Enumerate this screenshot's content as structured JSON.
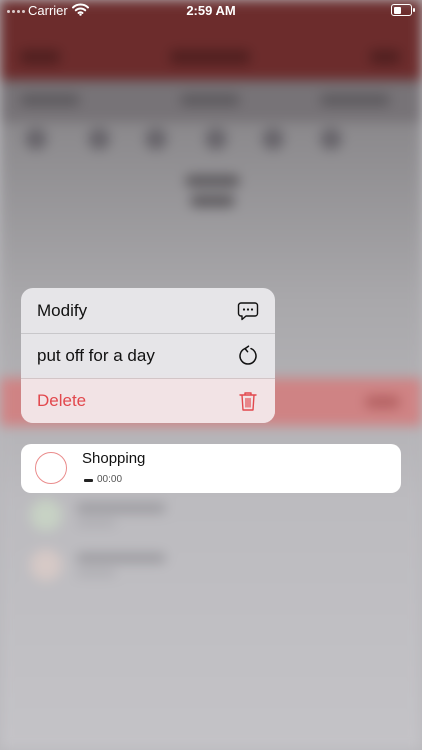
{
  "status_bar": {
    "carrier": "Carrier",
    "time": "2:59 AM"
  },
  "context_menu": {
    "items": [
      {
        "label": "Modify",
        "icon": "message-bubble-icon"
      },
      {
        "label": "put off for a day",
        "icon": "refresh-icon"
      },
      {
        "label": "Delete",
        "icon": "trash-icon",
        "destructive": true
      }
    ],
    "destructive_color": "#e2484d"
  },
  "task": {
    "title": "Shopping",
    "time": "00:00",
    "check_color": "#ea8c8c"
  }
}
